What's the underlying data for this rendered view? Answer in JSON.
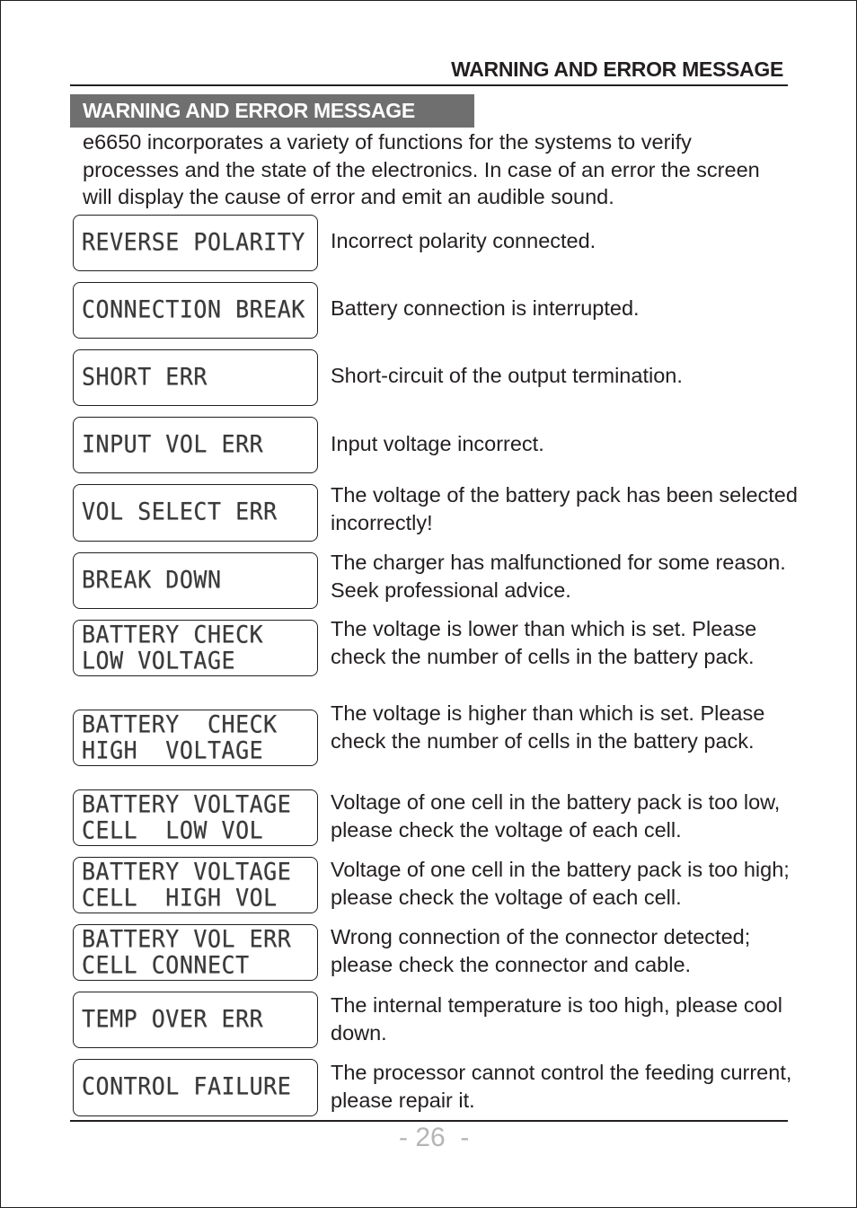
{
  "running_head": "WARNING AND ERROR MESSAGE",
  "section_title": "WARNING AND ERROR MESSAGE",
  "intro": "e6650 incorporates a variety of functions for the systems to verify processes and the state of the electronics. In case of an error the screen will display the cause of error and emit an audible sound.",
  "messages": [
    {
      "lcd": [
        "REVERSE POLARITY"
      ],
      "desc": "Incorrect polarity connected."
    },
    {
      "lcd": [
        "CONNECTION BREAK"
      ],
      "desc": "Battery connection is interrupted."
    },
    {
      "lcd": [
        "SHORT ERR"
      ],
      "desc": "Short-circuit of the output termination."
    },
    {
      "lcd": [
        "INPUT VOL ERR"
      ],
      "desc": "Input voltage incorrect."
    },
    {
      "lcd": [
        "VOL SELECT ERR"
      ],
      "desc": "The voltage of the battery pack has been selected incorrectly!"
    },
    {
      "lcd": [
        "BREAK DOWN"
      ],
      "desc": "The charger has malfunctioned for some reason. Seek professional advice."
    },
    {
      "lcd": [
        "BATTERY CHECK",
        "LOW VOLTAGE"
      ],
      "desc": "The voltage is lower than which is set. Please check the number of cells in the battery pack."
    },
    {
      "lcd": [
        "BATTERY  CHECK",
        "HIGH  VOLTAGE"
      ],
      "desc": "The voltage is higher than which is set. Please check the number of cells in the battery pack."
    },
    {
      "lcd": [
        "BATTERY VOLTAGE",
        "CELL  LOW VOL"
      ],
      "desc": "Voltage of one cell in the battery pack is too low, please check the voltage of each cell."
    },
    {
      "lcd": [
        "BATTERY VOLTAGE",
        "CELL  HIGH VOL"
      ],
      "desc": "Voltage of one cell in the battery pack is too high; please check the voltage of each cell."
    },
    {
      "lcd": [
        "BATTERY VOL ERR",
        "CELL CONNECT"
      ],
      "desc": "Wrong connection of the connector detected; please check the connector and cable."
    },
    {
      "lcd": [
        "TEMP OVER ERR"
      ],
      "desc": "The internal temperature is too high, please cool down."
    },
    {
      "lcd": [
        "CONTROL FAILURE"
      ],
      "desc": "The processor cannot control the feeding current, please repair it."
    }
  ],
  "page_number": "- 26  -"
}
